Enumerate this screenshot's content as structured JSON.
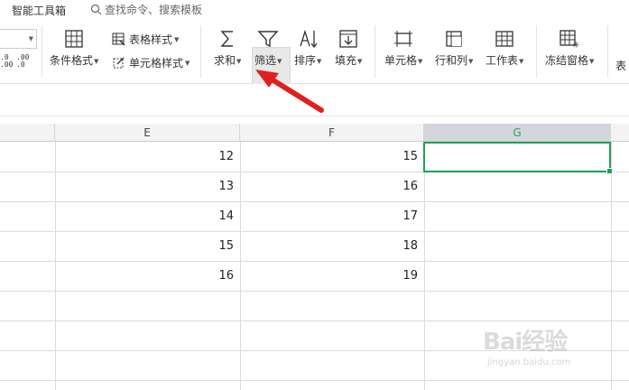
{
  "topbar": {
    "toolbox_label": "智能工具箱",
    "search_placeholder": "查找命令、搜索模板"
  },
  "ribbon": {
    "decimal_inc_label": ".0\n.00",
    "decimal_dec_label": ".00\n.0",
    "conditional_format": "条件格式",
    "table_style": "表格样式",
    "cell_style": "单元格样式",
    "sum": "求和",
    "filter": "筛选",
    "sort": "排序",
    "fill": "填充",
    "cell": "单元格",
    "row_col": "行和列",
    "worksheet": "工作表",
    "freeze": "冻结窗格",
    "table_partial": "表"
  },
  "sheet": {
    "columns": [
      "E",
      "F",
      "G"
    ],
    "selected_column": "G",
    "rows": [
      {
        "E": "12",
        "F": "15",
        "G": ""
      },
      {
        "E": "13",
        "F": "16",
        "G": ""
      },
      {
        "E": "14",
        "F": "17",
        "G": ""
      },
      {
        "E": "15",
        "F": "18",
        "G": ""
      },
      {
        "E": "16",
        "F": "19",
        "G": ""
      }
    ],
    "active_cell": "G1"
  },
  "colors": {
    "accent_green": "#1f9e5a",
    "arrow_red": "#e02020"
  },
  "watermark": {
    "brand": "Bai经验",
    "url": "jingyan.baidu.com"
  }
}
